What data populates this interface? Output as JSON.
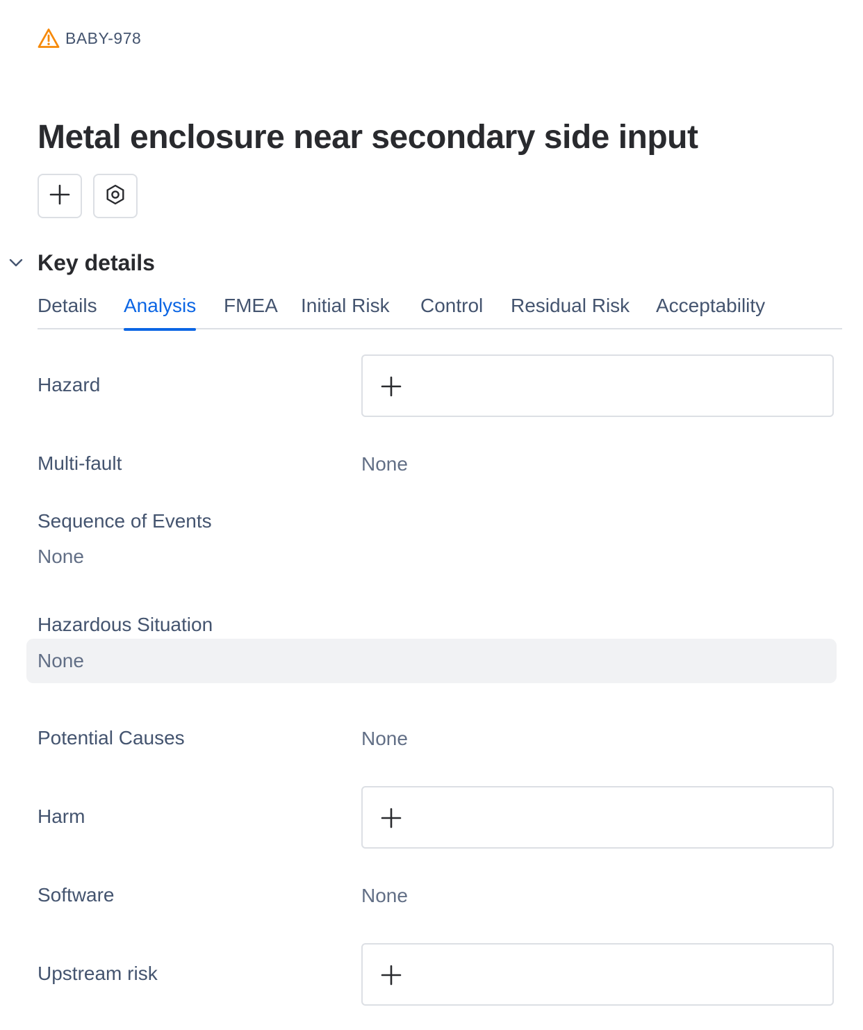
{
  "issue": {
    "key": "BABY-978",
    "icon": "warning-triangle-icon",
    "title": "Metal enclosure near secondary side input"
  },
  "actions": {
    "add_icon": "plus-icon",
    "apps_icon": "hexagon-settings-icon"
  },
  "section": {
    "title": "Key details",
    "toggle_icon": "chevron-down-icon"
  },
  "tabs": [
    {
      "label": "Details"
    },
    {
      "label": "Analysis",
      "active": true
    },
    {
      "label": "FMEA"
    },
    {
      "label": "Initial Risk"
    },
    {
      "label": "Control"
    },
    {
      "label": "Residual Risk"
    },
    {
      "label": "Acceptability"
    }
  ],
  "fields": {
    "hazard": {
      "label": "Hazard"
    },
    "multi_fault": {
      "label": "Multi-fault",
      "value": "None"
    },
    "sequence_of_events": {
      "label": "Sequence of Events",
      "value": "None"
    },
    "hazardous_situation": {
      "label": "Hazardous Situation",
      "value": "None"
    },
    "potential_causes": {
      "label": "Potential Causes",
      "value": "None"
    },
    "harm": {
      "label": "Harm"
    },
    "software": {
      "label": "Software",
      "value": "None"
    },
    "upstream_risk": {
      "label": "Upstream risk"
    }
  },
  "colors": {
    "accent": "#0c66e4",
    "warning": "#f68909",
    "text": "#292a2e",
    "subtle_text": "#44546f",
    "border": "#dcdfe4"
  }
}
